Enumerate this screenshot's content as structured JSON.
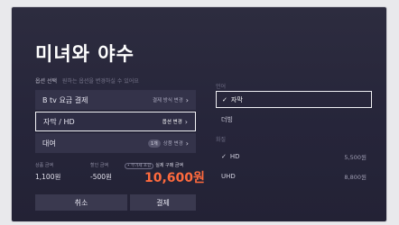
{
  "title": "미녀와 야수",
  "option_section": {
    "label": "옵션 선택",
    "hint": "원하는 옵션을 변경하실 수 있어요"
  },
  "options": [
    {
      "label": "B tv 요금 결제",
      "action": "결제 방식 변경"
    },
    {
      "label": "자막 / HD",
      "action": "옵션 변경"
    },
    {
      "label": "대여",
      "badge": "1개",
      "action": "상품 변경"
    }
  ],
  "summary": {
    "product_price_label": "상품 금액",
    "product_price": "1,100원",
    "discount_label": "할인 금액",
    "discount": "-500원",
    "vat_badge": "• 부가세 포함",
    "total_label": "실제 구매 금액",
    "total": "10,600원"
  },
  "buttons": {
    "cancel": "취소",
    "pay": "결제"
  },
  "language": {
    "label": "언어",
    "options": [
      "자막",
      "더빙"
    ]
  },
  "quality": {
    "label": "화질",
    "options": [
      {
        "name": "HD",
        "price": "5,500원"
      },
      {
        "name": "UHD",
        "price": "8,800원"
      }
    ]
  },
  "check_glyph": "✓"
}
